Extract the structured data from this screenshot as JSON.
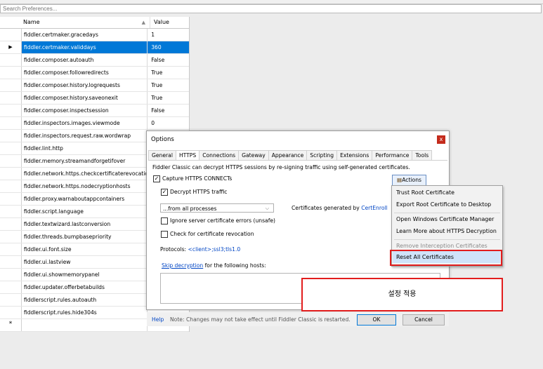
{
  "search": {
    "placeholder": "Search Preferences..."
  },
  "grid": {
    "col_name": "Name",
    "col_value": "Value",
    "rows": [
      {
        "name": "fiddler.certmaker.gracedays",
        "value": "1"
      },
      {
        "name": "fiddler.certmaker.validdays",
        "value": "360"
      },
      {
        "name": "fiddler.composer.autoauth",
        "value": "False"
      },
      {
        "name": "fiddler.composer.followredirects",
        "value": "True"
      },
      {
        "name": "fiddler.composer.history.logrequests",
        "value": "True"
      },
      {
        "name": "fiddler.composer.history.saveonexit",
        "value": "True"
      },
      {
        "name": "fiddler.composer.inspectsession",
        "value": "False"
      },
      {
        "name": "fiddler.inspectors.images.viewmode",
        "value": "0"
      },
      {
        "name": "fiddler.inspectors.request.raw.wordwrap",
        "value": ""
      },
      {
        "name": "fiddler.lint.http",
        "value": ""
      },
      {
        "name": "fiddler.memory.streamandforgetifover",
        "value": ""
      },
      {
        "name": "fiddler.network.https.checkcertificaterevocation",
        "value": ""
      },
      {
        "name": "fiddler.network.https.nodecryptionhosts",
        "value": ""
      },
      {
        "name": "fiddler.proxy.warnaboutappcontainers",
        "value": ""
      },
      {
        "name": "fiddler.script.language",
        "value": ""
      },
      {
        "name": "fiddler.textwizard.lastconversion",
        "value": ""
      },
      {
        "name": "fiddler.threads.bumpbasepriority",
        "value": ""
      },
      {
        "name": "fiddler.ui.font.size",
        "value": ""
      },
      {
        "name": "fiddler.ui.lastview",
        "value": ""
      },
      {
        "name": "fiddler.ui.showmemorypanel",
        "value": ""
      },
      {
        "name": "fiddler.updater.offerbetabuilds",
        "value": ""
      },
      {
        "name": "fiddlerscript.rules.autoauth",
        "value": ""
      },
      {
        "name": "fiddlerscript.rules.hide304s",
        "value": ""
      }
    ],
    "selected_marker": "▶",
    "new_row_marker": "*"
  },
  "dialog": {
    "title": "Options",
    "close_glyph": "x",
    "tabs": [
      "General",
      "HTTPS",
      "Connections",
      "Gateway",
      "Appearance",
      "Scripting",
      "Extensions",
      "Performance",
      "Tools"
    ],
    "active_tab": "HTTPS",
    "intro": "Fiddler Classic can decrypt HTTPS sessions by re-signing traffic using self-generated certificates.",
    "capture_label": "Capture HTTPS CONNECTs",
    "actions_label": "Actions",
    "decrypt_label": "Decrypt HTTPS traffic",
    "process_value": "...from all processes",
    "certs_generated_prefix": "Certificates generated by ",
    "certs_generated_link": "CertEnroll",
    "ignore_errors_label": "Ignore server certificate errors (unsafe)",
    "revocation_label": "Check for certificate revocation",
    "protocols_prefix": "Protocols: ",
    "protocols_value": "<client>;ssl3;tls1.0",
    "skip_link": "Skip decryption",
    "skip_suffix": " for the following hosts:",
    "help_link": "Help",
    "footer_note": "Note: Changes may not take effect until Fiddler Classic is restarted.",
    "ok_label": "OK",
    "cancel_label": "Cancel",
    "check_glyph": "✓"
  },
  "menu": {
    "items": [
      {
        "label": "Trust Root Certificate",
        "enabled": true
      },
      {
        "label": "Export Root Certificate to Desktop",
        "enabled": true
      },
      {
        "label": "Open Windows Certificate Manager",
        "enabled": true
      },
      {
        "label": "Learn More about HTTPS Decryption",
        "enabled": true
      },
      {
        "label": "Remove Interception Certificates",
        "enabled": false
      },
      {
        "label": "Reset All Certificates",
        "enabled": true
      }
    ]
  },
  "callout": {
    "text": "설정 적용"
  },
  "colors": {
    "selection": "#0078d7",
    "highlight_box": "#e21d1d",
    "link": "#0045c4"
  }
}
